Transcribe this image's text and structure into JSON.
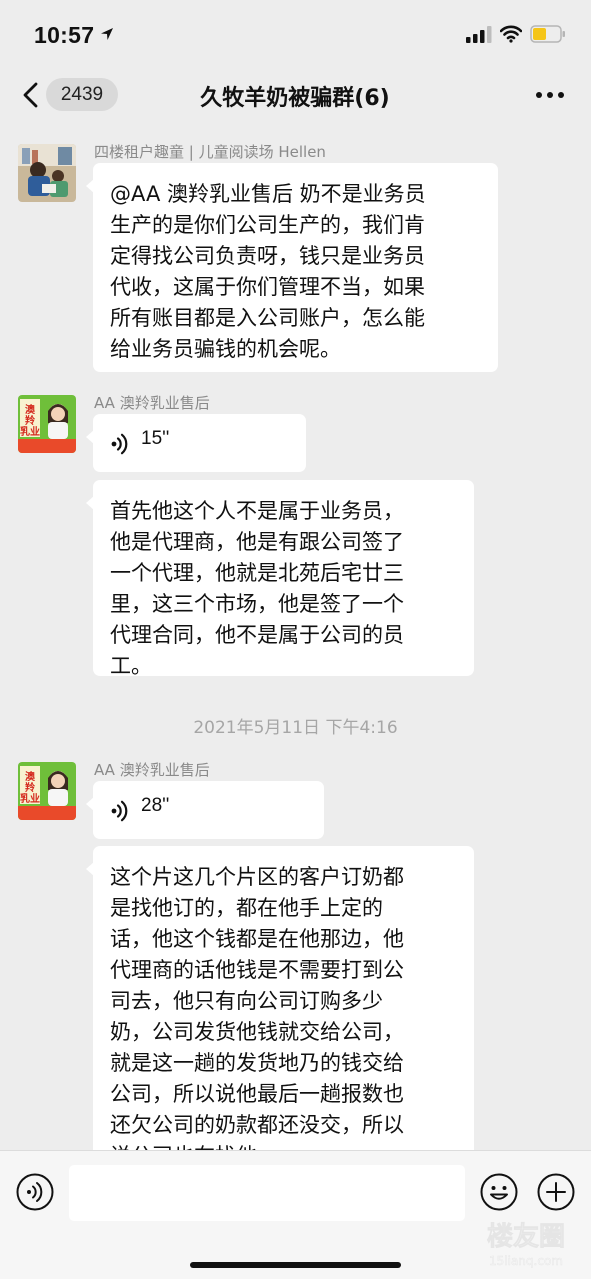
{
  "status_bar": {
    "time": "10:57",
    "icons": [
      "location-arrow-icon",
      "cellular-signal-icon",
      "wifi-icon",
      "battery-icon"
    ],
    "battery_color": "#f5c518"
  },
  "nav": {
    "back_icon": "chevron-left-icon",
    "unread_count": "2439",
    "title": "久牧羊奶被骗群(6)",
    "more_icon": "more-dots-icon"
  },
  "messages": [
    {
      "type": "text",
      "sender": "四楼租户趣童 | 儿童阅读场 Hellen",
      "text": "@AA 澳羚乳业售后 奶不是业务员\n生产的是你们公司生产的，我们肯\n定得找公司负责呀，钱只是业务员\n代收，这属于你们管理不当，如果\n所有账目都是入公司账户，怎么能\n给业务员骗钱的机会呢。"
    },
    {
      "type": "voice",
      "sender": "AA 澳羚乳业售后",
      "duration": "15''"
    },
    {
      "type": "text",
      "sender": "AA 澳羚乳业售后",
      "text": "首先他这个人不是属于业务员，\n他是代理商，他是有跟公司签了\n一个代理，他就是北苑后宅廿三\n里，这三个市场，他是签了一个\n代理合同，他不是属于公司的员\n工。"
    },
    {
      "type": "timestamp",
      "text": "2021年5月11日 下午4:16"
    },
    {
      "type": "voice",
      "sender": "AA 澳羚乳业售后",
      "duration": "28''"
    },
    {
      "type": "text",
      "sender": "AA 澳羚乳业售后",
      "text": "这个片这几个片区的客户订奶都\n是找他订的，都在他手上定的\n话，他这个钱都是在他那边，他\n代理商的话他钱是不需要打到公\n司去，他只有向公司订购多少\n奶，公司发货他钱就交给公司，\n就是这一趟的发货地乃的钱交给\n公司，所以说他最后一趟报数也\n还欠公司的奶款都还没交，所以\n说公司也在找他。"
    }
  ],
  "avatars": {
    "hellen": "photo of adult reading book with child",
    "aoling": "澳羚乳业",
    "aoling_brand_color": "#d42a1e"
  },
  "input_bar": {
    "icons": [
      "voice-input-icon",
      "emoji-icon",
      "add-icon"
    ],
    "placeholder": ""
  },
  "watermark": {
    "text": "楼友圈",
    "subtext": "15lianq.com"
  }
}
